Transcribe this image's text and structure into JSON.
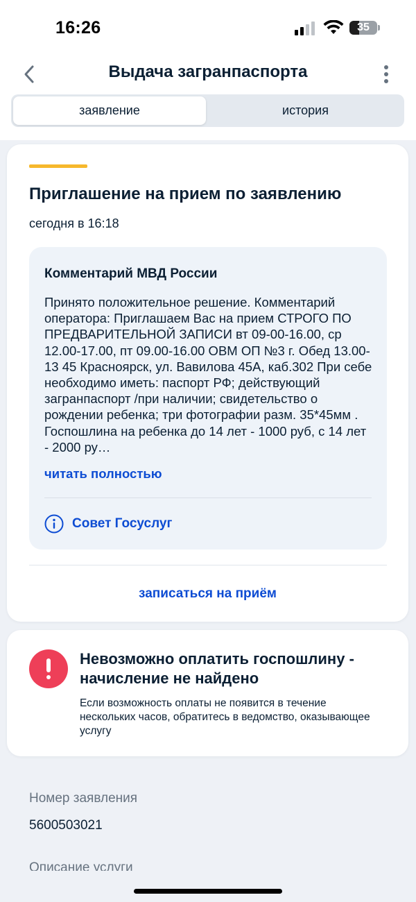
{
  "status_bar": {
    "time": "16:26",
    "battery": "35",
    "battery_level": 0.35,
    "icons": [
      "cellular-signal-icon",
      "wifi-icon",
      "battery-icon"
    ]
  },
  "header": {
    "title": "Выдача загранпаспорта",
    "back_icon": "chevron-left-icon",
    "more_icon": "more-vertical-icon"
  },
  "tabs": [
    {
      "label": "заявление",
      "active": true
    },
    {
      "label": "история",
      "active": false
    }
  ],
  "event_card": {
    "accent_color": "#f6b82c",
    "title": "Приглашение на прием по заявлению",
    "time": "сегодня в 16:18",
    "comment": {
      "heading": "Комментарий МВД России",
      "text": "Принято положительное решение. Комментарий оператора: Приглашаем Вас на прием СТРОГО ПО ПРЕДВАРИТЕЛЬНОЙ ЗАПИСИ вт  09-00-16.00, ср 12.00-17.00, пт 09.00-16.00 ОВМ ОП №3 г. Обед 13.00-13 45 Красноярск, ул. Вавилова 45А, каб.302 При себе необходимо иметь: паспорт РФ; действующий загранпаспорт /при наличии; свидетельство о рождении ребенка; три фотографии разм. 35*45мм . Госпошлина на ребенка до 14 лет - 1000 руб, с 14 лет - 2000 ру…",
      "read_more": "читать полностью",
      "tip_label": "Совет Госуслуг"
    },
    "action": "записаться на приём"
  },
  "error_card": {
    "title": "Невозможно оплатить госпошлину - начисление не найдено",
    "text": "Если возможность оплаты не появится в течение нескольких часов, обратитесь в ведомство, оказывающее услугу",
    "icon_color": "#ee3f58"
  },
  "details": {
    "number_label": "Номер заявления",
    "number_value": "5600503021",
    "description_label": "Описание услуги"
  },
  "colors": {
    "link": "#0d4cd3",
    "background": "#eef1f6",
    "text": "#0b1f33"
  }
}
